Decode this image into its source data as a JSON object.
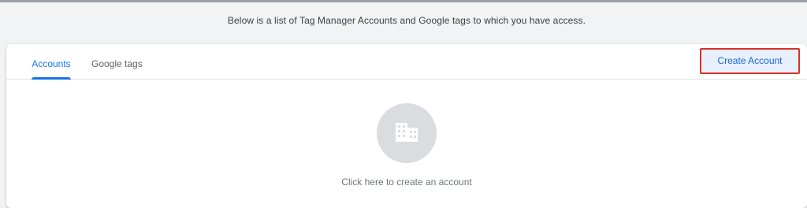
{
  "page": {
    "intro_text": "Below is a list of Tag Manager Accounts and Google tags to which you have access."
  },
  "tabs": [
    {
      "label": "Accounts",
      "selected": true
    },
    {
      "label": "Google tags",
      "selected": false
    }
  ],
  "toolbar": {
    "create_account_label": "Create Account"
  },
  "empty_state": {
    "icon": "building-icon",
    "message": "Click here to create an account"
  },
  "colors": {
    "accent": "#1a73e8",
    "highlight_border": "#d93025",
    "button_bg": "#e8f0fe",
    "page_bg": "#f1f3f4"
  }
}
